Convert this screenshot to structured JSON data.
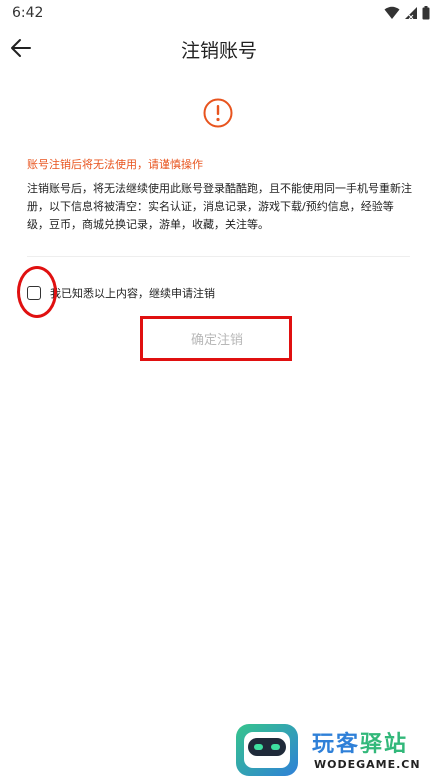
{
  "status_bar": {
    "time": "6:42",
    "icons": [
      "wifi-icon",
      "signal-icon",
      "battery-icon"
    ]
  },
  "app_bar": {
    "back_icon": "arrow-left-icon",
    "title": "注销账号"
  },
  "warning": {
    "icon": "exclamation-circle-icon",
    "headline": "账号注销后将无法使用，请谨慎操作",
    "description": "注销账号后，将无法继续使用此账号登录酷酷跑，且不能使用同一手机号重新注册，以下信息将被清空：实名认证，消息记录，游戏下载/预约信息，经验等级，豆币，商城兑换记录，游单，收藏，关注等。"
  },
  "agreement": {
    "checked": false,
    "label": "我已知悉以上内容，继续申请注销"
  },
  "confirm_button": {
    "label": "确定注销",
    "enabled": false
  },
  "watermark": {
    "title_part1": "玩客",
    "title_part2": "驿站",
    "subtitle": "WODEGAME.CN"
  },
  "colors": {
    "accent": "#e8541e",
    "annotation_red": "#e01010",
    "disabled_text": "#b8b8b8"
  }
}
